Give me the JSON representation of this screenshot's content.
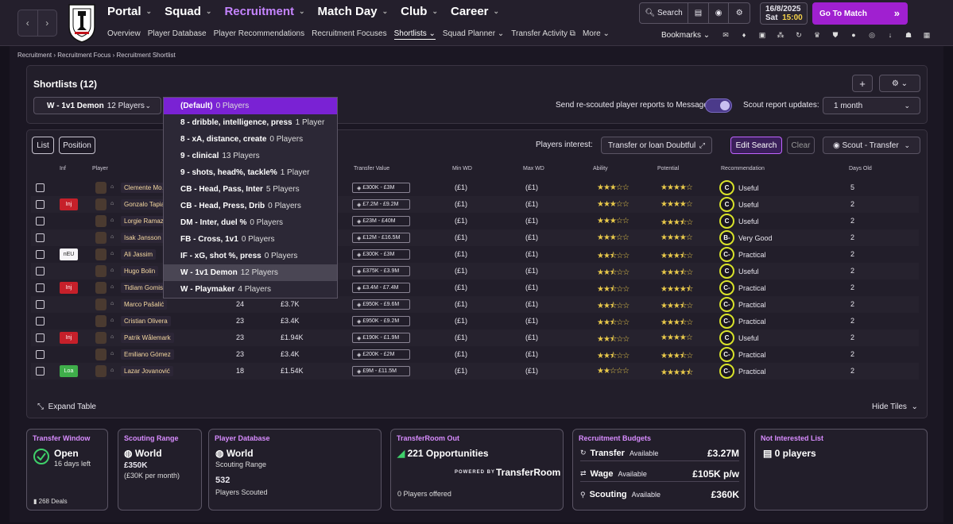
{
  "nav": {
    "items": [
      "Portal",
      "Squad",
      "Recruitment",
      "Match Day",
      "Club",
      "Career"
    ],
    "active": "Recruitment"
  },
  "subnav": {
    "items": [
      "Overview",
      "Player Database",
      "Player Recommendations",
      "Recruitment Focuses",
      "Shortlists",
      "Squad Planner",
      "Transfer Activity",
      "More"
    ],
    "active": "Shortlists"
  },
  "toolbar": {
    "search_label": "Search"
  },
  "date": {
    "date": "16/8/2025",
    "day": "Sat",
    "time": "15:00"
  },
  "gotomatch": {
    "label": "Go To Match"
  },
  "bookmarks": {
    "label": "Bookmarks"
  },
  "breadcrumb": [
    "Recruitment",
    "Recruitment Focus",
    "Recruitment Shortlist"
  ],
  "panel": {
    "title": "Shortlists (12)",
    "selected_shortlist": "W - 1v1 Demon",
    "selected_count": "12 Players",
    "send_label": "Send re-scouted player reports to Messages",
    "scout_updates_label": "Scout report updates:",
    "scout_updates_value": "1 month"
  },
  "table_controls": {
    "list": "List",
    "position": "Position",
    "players_interest_label": "Players interest:",
    "players_interest_value": "Transfer or loan  Doubtful",
    "edit_search": "Edit Search",
    "clear": "Clear",
    "scout_view": "Scout - Transfer"
  },
  "columns": {
    "inf": "Inf",
    "player": "Player",
    "transfer_value": "Transfer Value",
    "min_wd": "Min WD",
    "max_wd": "Max WD",
    "ability": "Ability",
    "potential": "Potential",
    "recommendation": "Recommendation",
    "days_old": "Days Old"
  },
  "rows": [
    {
      "badge": "",
      "name": "Clemente Mo…",
      "age": "",
      "value": "",
      "tv": "£300K - £3M",
      "min": "(£1)",
      "max": "(£1)",
      "ability": "★★★☆☆",
      "potential": "★★★★☆",
      "grade": "C",
      "rec": "Useful",
      "days": "5"
    },
    {
      "badge": "Inj",
      "name": "Gonzalo Tapia",
      "age": "",
      "value": "",
      "tv": "£7.2M - £9.2M",
      "min": "(£1)",
      "max": "(£1)",
      "ability": "★★★☆☆",
      "potential": "★★★★☆",
      "grade": "C",
      "rec": "Useful",
      "days": "2"
    },
    {
      "badge": "",
      "name": "Lorgie Ramaz…",
      "age": "",
      "value": "",
      "tv": "£23M - £40M",
      "min": "(£1)",
      "max": "(£1)",
      "ability": "★★★☆☆",
      "potential": "★★★⯪☆",
      "grade": "C",
      "rec": "Useful",
      "days": "2"
    },
    {
      "badge": "",
      "name": "Isak Jansson",
      "age": "",
      "value": "",
      "tv": "£12M - £16.5M",
      "min": "(£1)",
      "max": "(£1)",
      "ability": "★★★☆☆",
      "potential": "★★★★☆",
      "grade": "B-",
      "rec": "Very Good",
      "days": "2"
    },
    {
      "badge": "nEU",
      "name": "Ali Jassim",
      "age": "",
      "value": "",
      "tv": "£300K - £3M",
      "min": "(£1)",
      "max": "(£1)",
      "ability": "★★⯪☆☆",
      "potential": "★★★⯪☆",
      "grade": "C-",
      "rec": "Practical",
      "days": "2"
    },
    {
      "badge": "",
      "name": "Hugo Bolin",
      "age": "",
      "value": "",
      "tv": "£375K - £3.9M",
      "min": "(£1)",
      "max": "(£1)",
      "ability": "★★⯪☆☆",
      "potential": "★★★⯪☆",
      "grade": "C",
      "rec": "Useful",
      "days": "2"
    },
    {
      "badge": "Inj",
      "name": "Tidiam Gomis",
      "age": "",
      "value": "",
      "tv": "£3.4M - £7.4M",
      "min": "(£1)",
      "max": "(£1)",
      "ability": "★★⯪☆☆",
      "potential": "★★★★⯪",
      "grade": "C-",
      "rec": "Practical",
      "days": "2"
    },
    {
      "badge": "",
      "name": "Marco Pašalić",
      "age": "24",
      "value": "£3.7K",
      "tv": "£950K - £9.6M",
      "min": "(£1)",
      "max": "(£1)",
      "ability": "★★⯪☆☆",
      "potential": "★★★⯪☆",
      "grade": "C-",
      "rec": "Practical",
      "days": "2"
    },
    {
      "badge": "",
      "name": "Cristian Olivera",
      "age": "23",
      "value": "£3.4K",
      "tv": "£950K - £9.2M",
      "min": "(£1)",
      "max": "(£1)",
      "ability": "★★⯪☆☆",
      "potential": "★★★⯪☆",
      "grade": "C-",
      "rec": "Practical",
      "days": "2"
    },
    {
      "badge": "Inj",
      "name": "Patrik Wålemark",
      "age": "23",
      "value": "£1.94K",
      "tv": "£190K - £1.9M",
      "min": "(£1)",
      "max": "(£1)",
      "ability": "★★⯪☆☆",
      "potential": "★★★★☆",
      "grade": "C",
      "rec": "Useful",
      "days": "2"
    },
    {
      "badge": "",
      "name": "Emiliano Gómez",
      "age": "23",
      "value": "£3.4K",
      "tv": "£200K - £2M",
      "min": "(£1)",
      "max": "(£1)",
      "ability": "★★⯪☆☆",
      "potential": "★★★⯪☆",
      "grade": "C-",
      "rec": "Practical",
      "days": "2"
    },
    {
      "badge": "Loa",
      "name": "Lazar Jovanović",
      "age": "18",
      "value": "£1.54K",
      "tv": "£9M - £11.5M",
      "min": "(£1)",
      "max": "(£1)",
      "ability": "★★☆☆☆",
      "potential": "★★★★⯪",
      "grade": "C-",
      "rec": "Practical",
      "days": "2"
    }
  ],
  "footer": {
    "expand": "Expand Table",
    "hide_tiles": "Hide Tiles"
  },
  "dropdown": [
    {
      "name": "(Default)",
      "count": "0 Players"
    },
    {
      "name": "8 - dribble, intelligence, press",
      "count": "1 Player"
    },
    {
      "name": "8 - xA, distance, create",
      "count": "0 Players"
    },
    {
      "name": "9 - clinical",
      "count": "13 Players"
    },
    {
      "name": "9 - shots, head%, tackle%",
      "count": "1 Player"
    },
    {
      "name": "CB - Head, Pass, Inter",
      "count": "5 Players"
    },
    {
      "name": "CB - Head, Press, Drib",
      "count": "0 Players"
    },
    {
      "name": "DM - Inter, duel %",
      "count": "0 Players"
    },
    {
      "name": "FB - Cross, 1v1",
      "count": "0 Players"
    },
    {
      "name": "IF - xG, shot %, press",
      "count": "0 Players"
    },
    {
      "name": "W - 1v1 Demon",
      "count": "12 Players"
    },
    {
      "name": "W - Playmaker",
      "count": "4 Players"
    }
  ],
  "tiles": {
    "transfer_window": {
      "title": "Transfer Window",
      "status": "Open",
      "days": "16 days left",
      "deals": "268",
      "deals_label": "Deals"
    },
    "scouting_range": {
      "title": "Scouting Range",
      "range": "World",
      "cost": "£350K",
      "per_month": "(£30K per month)"
    },
    "player_db": {
      "title": "Player Database",
      "range": "World",
      "range_label": "Scouting Range",
      "count": "532",
      "count_label": "Players Scouted"
    },
    "transferroom": {
      "title": "TransferRoom Out",
      "opps": "221 Opportunities",
      "powered": "POWERED BY",
      "brand": "TransferRoom",
      "offered": "0 Players offered"
    },
    "budgets": {
      "title": "Recruitment Budgets",
      "transfer": "Transfer",
      "transfer_value": "£3.27M",
      "wage": "Wage",
      "wage_value": "£105K p/w",
      "scouting": "Scouting",
      "scouting_value": "£360K",
      "available": "Available"
    },
    "not_interested": {
      "title": "Not Interested List",
      "count": "0 players"
    }
  }
}
